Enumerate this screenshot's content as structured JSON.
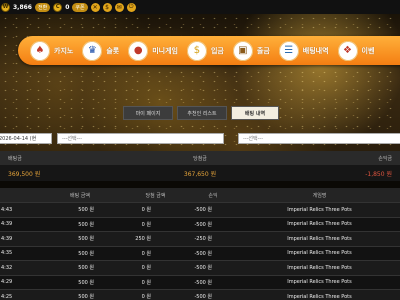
{
  "topbar": {
    "points": "3,866",
    "points_badge": "전환",
    "coupon": "0",
    "coupon_badge": "쿠폰"
  },
  "nav": {
    "items": [
      {
        "label": "카지노",
        "icon": "casino-chip-icon"
      },
      {
        "label": "슬롯",
        "icon": "slot-icon"
      },
      {
        "label": "미니게임",
        "icon": "minigame-icon"
      },
      {
        "label": "입금",
        "icon": "deposit-coins-icon"
      },
      {
        "label": "출금",
        "icon": "withdraw-wallet-icon"
      },
      {
        "label": "배팅내역",
        "icon": "bet-history-icon"
      },
      {
        "label": "이벤",
        "icon": "gift-icon"
      }
    ]
  },
  "tabs": [
    {
      "label": "마이 페이지",
      "active": false
    },
    {
      "label": "추천인 리스트",
      "active": false
    },
    {
      "label": "배팅 내역",
      "active": true
    }
  ],
  "filters": {
    "date": "2026-04-14 (현",
    "select1": "---선택---",
    "select2": "---선택---"
  },
  "summary": {
    "headers": [
      "배팅금",
      "당첨금",
      "손익금"
    ],
    "values": [
      "369,500 원",
      "367,650 원",
      "-1,850 원"
    ]
  },
  "table": {
    "headers": [
      "",
      "배팅 금액",
      "당첨 금액",
      "손익",
      "게임명"
    ],
    "rows": [
      {
        "time": "4:43",
        "bet": "500 원",
        "win": "0 원",
        "profit": "-500 원",
        "game": "Imperial Relics Three Pots"
      },
      {
        "time": "4:39",
        "bet": "500 원",
        "win": "0 원",
        "profit": "-500 원",
        "game": "Imperial Relics Three Pots"
      },
      {
        "time": "4:39",
        "bet": "500 원",
        "win": "250 원",
        "profit": "-250 원",
        "game": "Imperial Relics Three Pots"
      },
      {
        "time": "4:35",
        "bet": "500 원",
        "win": "0 원",
        "profit": "-500 원",
        "game": "Imperial Relics Three Pots"
      },
      {
        "time": "4:32",
        "bet": "500 원",
        "win": "0 원",
        "profit": "-500 원",
        "game": "Imperial Relics Three Pots"
      },
      {
        "time": "4:29",
        "bet": "500 원",
        "win": "0 원",
        "profit": "-500 원",
        "game": "Imperial Relics Three Pots"
      },
      {
        "time": "4:25",
        "bet": "500 원",
        "win": "0 원",
        "profit": "-500 원",
        "game": "Imperial Relics Three Pots"
      }
    ]
  },
  "colors": {
    "nav_orange": "#f47e12",
    "loss_red": "#e0553f",
    "gold": "#e6a43a"
  }
}
